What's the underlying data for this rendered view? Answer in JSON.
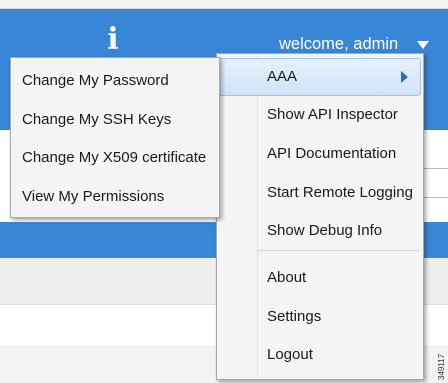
{
  "header": {
    "info_icon": "i",
    "welcome_text": "welcome, admin"
  },
  "user_menu": {
    "items": [
      {
        "label": "AAA",
        "has_submenu": true
      },
      {
        "label": "Show API Inspector"
      },
      {
        "label": "API Documentation"
      },
      {
        "label": "Start Remote Logging"
      },
      {
        "label": "Show Debug Info"
      },
      {
        "label": "About"
      },
      {
        "label": "Settings"
      },
      {
        "label": "Logout"
      }
    ]
  },
  "aaa_submenu": {
    "items": [
      {
        "label": "Change My Password"
      },
      {
        "label": "Change My SSH Keys"
      },
      {
        "label": "Change My X509 certificate"
      },
      {
        "label": "View My Permissions"
      }
    ]
  },
  "figure_number": "349117",
  "colors": {
    "header_blue": "#3a86d6",
    "menu_bg": "#f4f4f4",
    "highlight": "#cfe3f7",
    "arrow": "#2a6db8"
  }
}
